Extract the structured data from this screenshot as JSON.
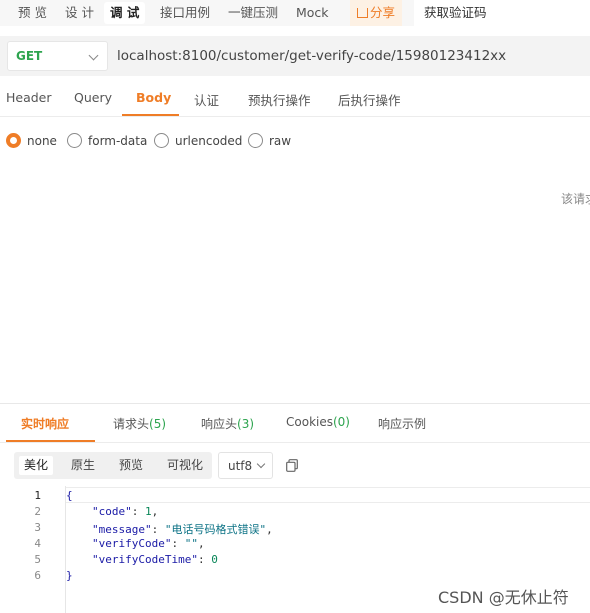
{
  "mode_tabs": [
    "预 览",
    "设 计",
    "调 试",
    "接口用例",
    "一键压测",
    "Mock"
  ],
  "share_label": "分享",
  "api_name": "获取验证码",
  "request": {
    "method": "GET",
    "url": "localhost:8100/customer/get-verify-code/15980123412xx"
  },
  "request_tabs": [
    "Header",
    "Query",
    "Body",
    "认证",
    "预执行操作",
    "后执行操作"
  ],
  "body_types": [
    "none",
    "form-data",
    "urlencoded",
    "raw"
  ],
  "body_hint": "该请求",
  "response_tabs": {
    "realtime": "实时响应",
    "req_headers": "请求头",
    "req_headers_count": "(5)",
    "resp_headers": "响应头",
    "resp_headers_count": "(3)",
    "cookies": "Cookies",
    "cookies_count": "(0)",
    "examples": "响应示例"
  },
  "view_modes": [
    "美化",
    "原生",
    "预览",
    "可视化"
  ],
  "encoding": "utf8",
  "code": {
    "line_numbers": [
      "1",
      "2",
      "3",
      "4",
      "5",
      "6"
    ],
    "open_brace": "{",
    "close_brace": "}",
    "key_code": "\"code\"",
    "val_code": "1",
    "key_message": "\"message\"",
    "val_message": "\"电话号码格式错误\"",
    "key_verifyCode": "\"verifyCode\"",
    "val_verifyCode": "\"\"",
    "key_verifyCodeTime": "\"verifyCodeTime\"",
    "val_verifyCodeTime": "0"
  },
  "watermark": "CSDN @无休止符",
  "colors": {
    "accent": "#ef7d27",
    "get_method": "#2ea44f",
    "count_green": "#2ea44f"
  }
}
